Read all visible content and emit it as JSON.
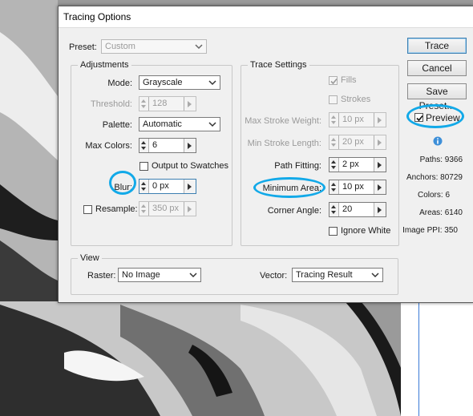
{
  "dialog": {
    "title": "Tracing Options",
    "preset": {
      "label": "Preset:",
      "value": "Custom"
    },
    "adjustments": {
      "legend": "Adjustments",
      "mode": {
        "label": "Mode:",
        "value": "Grayscale"
      },
      "threshold": {
        "label": "Threshold:",
        "value": "128"
      },
      "palette": {
        "label": "Palette:",
        "value": "Automatic"
      },
      "max_colors": {
        "label": "Max Colors:",
        "value": "6"
      },
      "output_to_swatches": {
        "label": "Output to Swatches",
        "checked": false
      },
      "blur": {
        "label": "Blur:",
        "value": "0 px"
      },
      "resample": {
        "label": "Resample:",
        "value": "350 px",
        "checked": false
      }
    },
    "trace_settings": {
      "legend": "Trace Settings",
      "fills": {
        "label": "Fills",
        "checked": true
      },
      "strokes": {
        "label": "Strokes",
        "checked": false
      },
      "max_stroke_weight": {
        "label": "Max Stroke Weight:",
        "value": "10 px"
      },
      "min_stroke_length": {
        "label": "Min Stroke Length:",
        "value": "20 px"
      },
      "path_fitting": {
        "label": "Path Fitting:",
        "value": "2 px"
      },
      "minimum_area": {
        "label": "Minimum Area:",
        "value": "10 px"
      },
      "corner_angle": {
        "label": "Corner Angle:",
        "value": "20"
      },
      "ignore_white": {
        "label": "Ignore White",
        "checked": false
      }
    },
    "view": {
      "legend": "View",
      "raster": {
        "label": "Raster:",
        "value": "No Image"
      },
      "vector": {
        "label": "Vector:",
        "value": "Tracing Result"
      }
    },
    "buttons": {
      "trace": "Trace",
      "cancel": "Cancel",
      "save_preset": "Save Preset..."
    },
    "preview": {
      "label": "Preview",
      "checked": true
    },
    "stats": {
      "paths": "Paths: 9366",
      "anchors": "Anchors: 80729",
      "colors": "Colors: 6",
      "areas": "Areas: 6140",
      "image_ppi": "Image PPI: 350"
    }
  },
  "colors": {
    "annotation": "#12a9e8",
    "default_button_border": "#3c7fb1"
  }
}
